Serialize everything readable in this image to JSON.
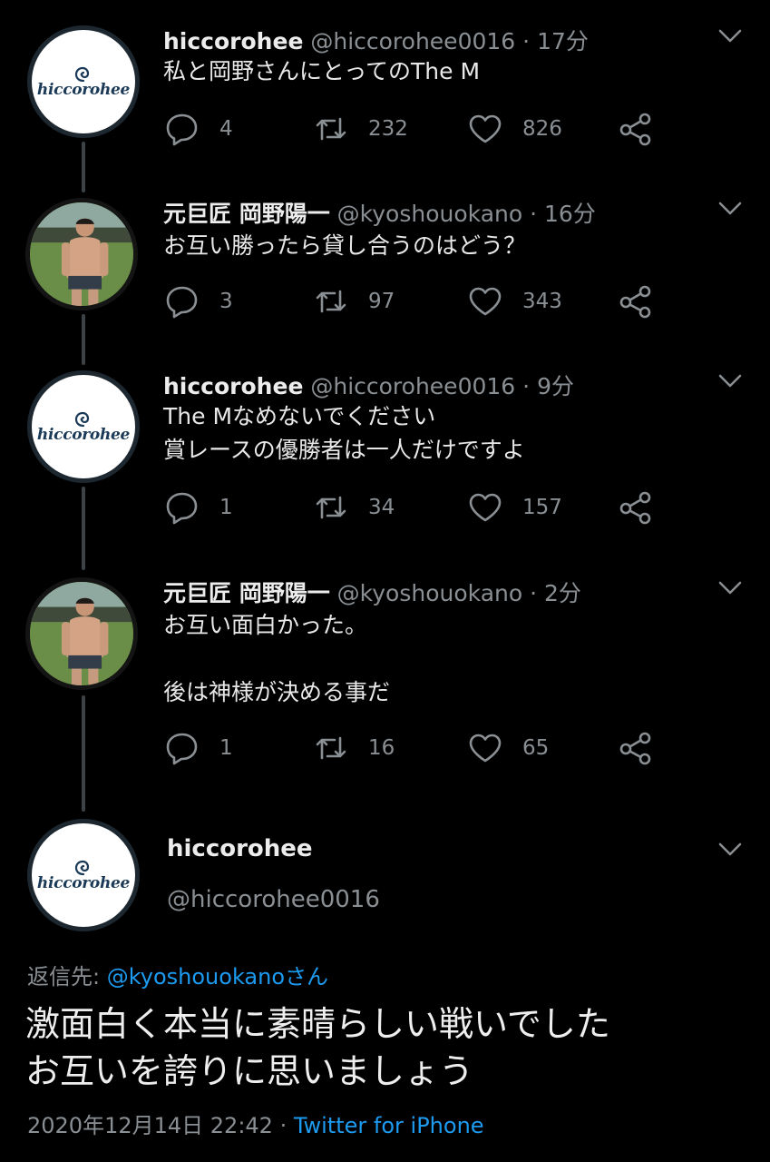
{
  "tweets": [
    {
      "name": "hiccorohee",
      "handle": "@hiccorohee0016",
      "sep": "·",
      "time": "17分",
      "text": "私と岡野さんにとってのThe M",
      "replies": "4",
      "retweets": "232",
      "likes": "826",
      "avatar": "hiccorohee-logo"
    },
    {
      "name": "元巨匠 岡野陽一",
      "handle": "@kyoshouokano",
      "sep": "·",
      "time": "16分",
      "text": "お互い勝ったら貸し合うのはどう？",
      "replies": "3",
      "retweets": "97",
      "likes": "343",
      "avatar": "okano-photo"
    },
    {
      "name": "hiccorohee",
      "handle": "@hiccorohee0016",
      "sep": "·",
      "time": "9分",
      "text": "The Mなめないでください\n賞レースの優勝者は一人だけですよ",
      "replies": "1",
      "retweets": "34",
      "likes": "157",
      "avatar": "hiccorohee-logo"
    },
    {
      "name": "元巨匠 岡野陽一",
      "handle": "@kyoshouokano",
      "sep": "·",
      "time": "2分",
      "text": "お互い面白かった。\n\n後は神様が決める事だ",
      "replies": "1",
      "retweets": "16",
      "likes": "65",
      "avatar": "okano-photo"
    }
  ],
  "main_tweet": {
    "name": "hiccorohee",
    "handle": "@hiccorohee0016",
    "reply_label": "返信先: ",
    "reply_mention": "@kyoshouokanoさん",
    "text": "激面白く本当に素晴らしい戦いでした\nお互いを誇りに思いましょう",
    "timestamp": "2020年12月14日 22:42",
    "meta_sep": " · ",
    "source": "Twitter for iPhone"
  },
  "logo": {
    "text": "hiccorohee"
  },
  "colors": {
    "background": "#000000",
    "text": "#d9d9d9",
    "muted": "#8a8f94",
    "link": "#1d9bf0",
    "thread_line": "#3d4246"
  },
  "icons": [
    "reply-icon",
    "retweet-icon",
    "like-icon",
    "share-icon",
    "chevron-down-icon"
  ]
}
